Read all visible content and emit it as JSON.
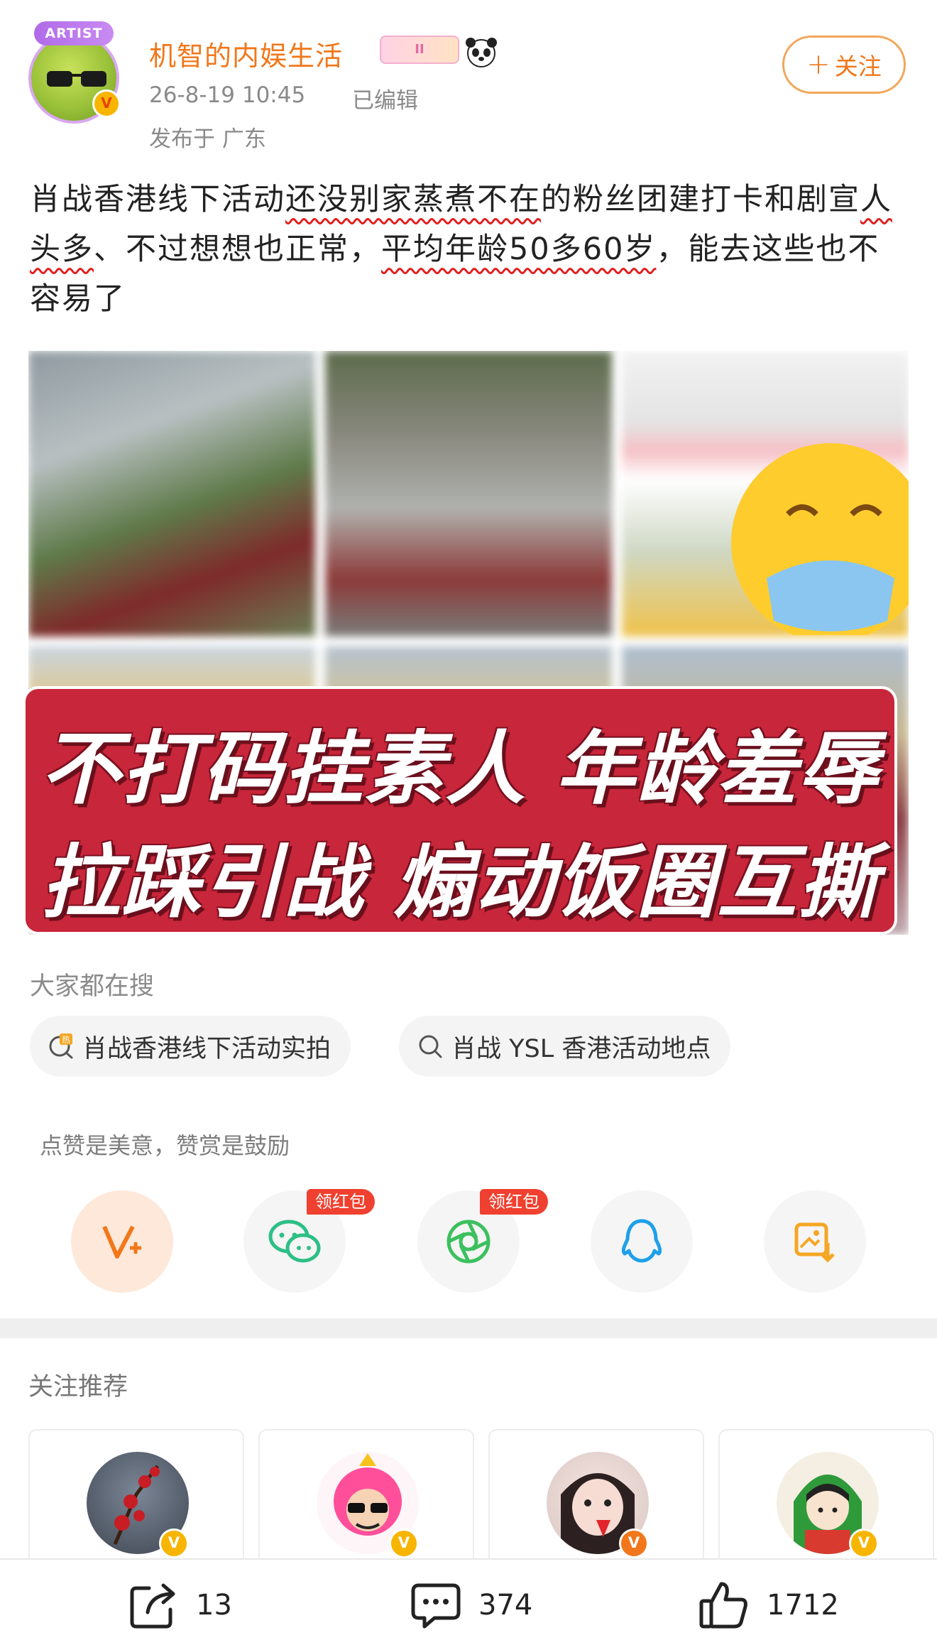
{
  "post": {
    "author": {
      "badge": "ARTIST",
      "name": "机智的内娱生活",
      "title_badge_text": "II"
    },
    "timestamp": "26-8-19 10:45",
    "edited": "已编辑",
    "location": "发布于 广东",
    "follow_label": "关注",
    "text": {
      "p1": "肖战香港线下活动",
      "p2": "还没别家蒸煮不在",
      "p3": "的粉丝团建打卡和剧宣",
      "p4": "人头多",
      "p5": "、不过想想也正常，",
      "p6": "平均年龄50多60岁",
      "p7": "，能去这些也不容易了"
    },
    "image_banner": {
      "line1": "不打码挂素人 年龄羞辱",
      "line2": "拉踩引战 煽动饭圈互撕"
    }
  },
  "search": {
    "section_label": "大家都在搜",
    "chips": [
      {
        "label": "肖战香港线下活动实拍",
        "icon": "hot-search-icon"
      },
      {
        "label": "肖战 YSL 香港活动地点",
        "icon": "search-icon"
      }
    ]
  },
  "reward": {
    "hint": "点赞是美意，赞赏是鼓励",
    "red_packet_label": "领红包"
  },
  "recommend": {
    "section_label": "关注推荐"
  },
  "bottom_bar": {
    "repost_count": "13",
    "comment_count": "374",
    "like_count": "1712"
  },
  "colors": {
    "accent_orange": "#f1771a",
    "banner_red": "#c8263a",
    "wavy_red": "#e02020",
    "red_packet": "#f0402f"
  }
}
